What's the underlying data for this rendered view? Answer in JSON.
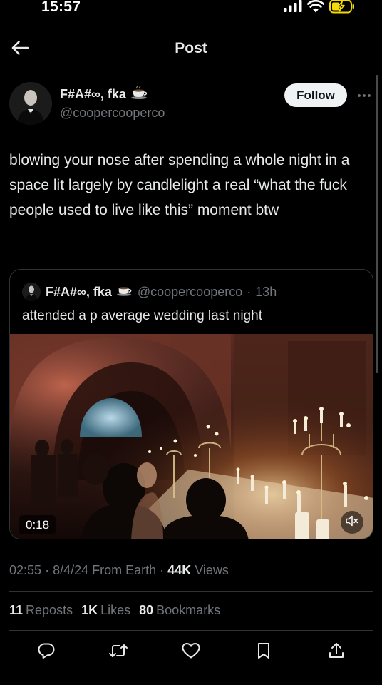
{
  "status_bar": {
    "time": "15:57"
  },
  "nav": {
    "title": "Post",
    "back_icon": "arrow-left-icon"
  },
  "post": {
    "author_name": "F#A#∞, fka",
    "author_handle": "@coopercooperco",
    "follow_label": "Follow",
    "text": "blowing your nose after spending a whole night in a space lit largely by candlelight a real “what the fuck people used to live like this” moment btw",
    "time": "02:55",
    "date": "8/4/24",
    "source": "From Earth",
    "views_count": "44K",
    "views_label": "Views"
  },
  "quote": {
    "author_name": "F#A#∞, fka",
    "author_handle": "@coopercooperco",
    "age": "13h",
    "text": "attended a p average wedding last night",
    "video_duration": "0:18"
  },
  "stats": {
    "reposts_count": "11",
    "reposts_label": "Reposts",
    "likes_count": "1K",
    "likes_label": "Likes",
    "bookmarks_count": "80",
    "bookmarks_label": "Bookmarks"
  },
  "actions": [
    "reply-icon",
    "repost-icon",
    "like-icon",
    "bookmark-icon",
    "share-icon"
  ],
  "colors": {
    "background": "#000000",
    "text_primary": "#e7e9ea",
    "text_secondary": "#71767b",
    "divider": "#2f3336",
    "follow_bg": "#eff3f4",
    "battery_charging": "#f5d90a"
  }
}
